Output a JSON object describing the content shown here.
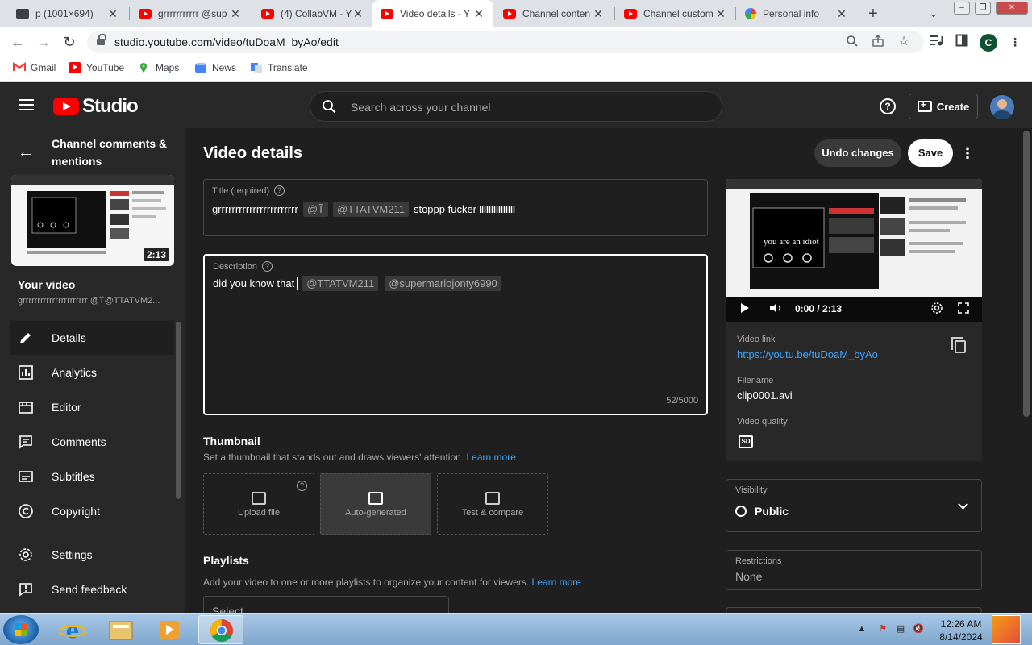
{
  "browser": {
    "tabs": [
      {
        "label": "p (1001×694)",
        "icon": "image-favicon"
      },
      {
        "label": "grrrrrrrrrrr @sup",
        "icon": "youtube-favicon"
      },
      {
        "label": "(4) CollabVM - Y",
        "icon": "youtube-favicon"
      },
      {
        "label": "Video details - Y",
        "icon": "youtube-favicon"
      },
      {
        "label": "Channel conten",
        "icon": "youtube-favicon"
      },
      {
        "label": "Channel custom",
        "icon": "youtube-favicon"
      },
      {
        "label": "Personal info",
        "icon": "google-favicon"
      }
    ],
    "url": "studio.youtube.com/video/tuDoaM_byAo/edit",
    "profile_initial": "C",
    "bookmarks": [
      "Gmail",
      "YouTube",
      "Maps",
      "News",
      "Translate"
    ]
  },
  "studio": {
    "logo_text": "Studio",
    "search_placeholder": "Search across your channel",
    "create_label": "Create"
  },
  "sidebar": {
    "channel_title": "Channel comments & mentions",
    "thumb_duration": "2:13",
    "your_video_label": "Your video",
    "your_video_title": "grrrrrrrrrrrrrrrrrrrrrr @T̃@TTATVM2...",
    "items": [
      {
        "label": "Details",
        "icon": "pencil-icon",
        "active": true
      },
      {
        "label": "Analytics",
        "icon": "analytics-icon"
      },
      {
        "label": "Editor",
        "icon": "editor-icon"
      },
      {
        "label": "Comments",
        "icon": "comments-icon"
      },
      {
        "label": "Subtitles",
        "icon": "subtitles-icon"
      },
      {
        "label": "Copyright",
        "icon": "copyright-icon"
      },
      {
        "label": "Settings",
        "icon": "gear-icon"
      },
      {
        "label": "Send feedback",
        "icon": "feedback-icon"
      }
    ]
  },
  "details": {
    "page_title": "Video details",
    "undo_label": "Undo changes",
    "save_label": "Save",
    "title_field": {
      "label": "Title (required)",
      "text": "grrrrrrrrrrrrrrrrrrrrrrr",
      "chip1": "@T̃",
      "chip2": "@TTATVM211",
      "suffix": "stoppp fucker"
    },
    "description_field": {
      "label": "Description",
      "text": "did you know that",
      "chip1": "@TTATVM211",
      "chip2": "@supermariojonty6990",
      "counter": "52/5000"
    },
    "thumbnail": {
      "title": "Thumbnail",
      "desc": "Set a thumbnail that stands out and draws viewers' attention.",
      "learn_more": "Learn more",
      "options": [
        "Upload file",
        "Auto-generated",
        "Test & compare"
      ]
    },
    "playlists": {
      "title": "Playlists",
      "desc": "Add your video to one or more playlists to organize your content for viewers.",
      "learn_more": "Learn more",
      "select_placeholder": "Select"
    }
  },
  "video_panel": {
    "time": "0:00 / 2:13",
    "video_link_label": "Video link",
    "video_link": "https://youtu.be/tuDoaM_byAo",
    "filename_label": "Filename",
    "filename": "clip0001.avi",
    "quality_label": "Video quality",
    "quality_badge": "SD",
    "preview_text": "you are an idiot"
  },
  "visibility": {
    "label": "Visibility",
    "value": "Public"
  },
  "restrictions": {
    "label": "Restrictions",
    "value": "None"
  },
  "taskbar": {
    "time": "12:26 AM",
    "date": "8/14/2024"
  },
  "colors": {
    "studio_bg": "#1f1f1f",
    "panel_bg": "#282828",
    "accent_link": "#3ea6ff",
    "youtube_red": "#ff0000"
  }
}
